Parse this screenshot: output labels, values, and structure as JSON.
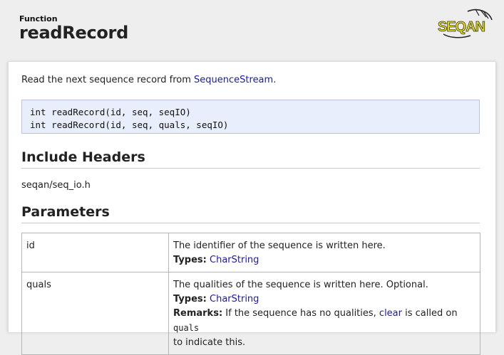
{
  "header": {
    "kind": "Function",
    "title": "readRecord",
    "logo_text": "SEQAN"
  },
  "intro": {
    "text": "Read the next sequence record from ",
    "link": "SequenceStream",
    "suffix": "."
  },
  "signatures": [
    "int readRecord(id, seq, seqIO)",
    "int readRecord(id, seq, quals, seqIO)"
  ],
  "include": {
    "heading": "Include Headers",
    "path": "seqan/seq_io.h"
  },
  "parameters": {
    "heading": "Parameters",
    "rows": [
      {
        "name": "id",
        "desc": "The identifier of the sequence is written here.",
        "types_label": "Types:",
        "types_link": "CharString"
      },
      {
        "name": "quals",
        "desc": "The qualities of the sequence is written here. Optional.",
        "types_label": "Types:",
        "types_link": "CharString",
        "remarks_label": "Remarks:",
        "remarks_pre": " If the sequence has no qualities, ",
        "remarks_link": "clear",
        "remarks_mid": " is called on ",
        "remarks_code": "quals",
        "remarks_post": "to indicate this."
      }
    ]
  },
  "colors": {
    "link": "#1a1aa8",
    "code_bg": "#e8eefb",
    "logo_yellow": "#e8e000"
  }
}
